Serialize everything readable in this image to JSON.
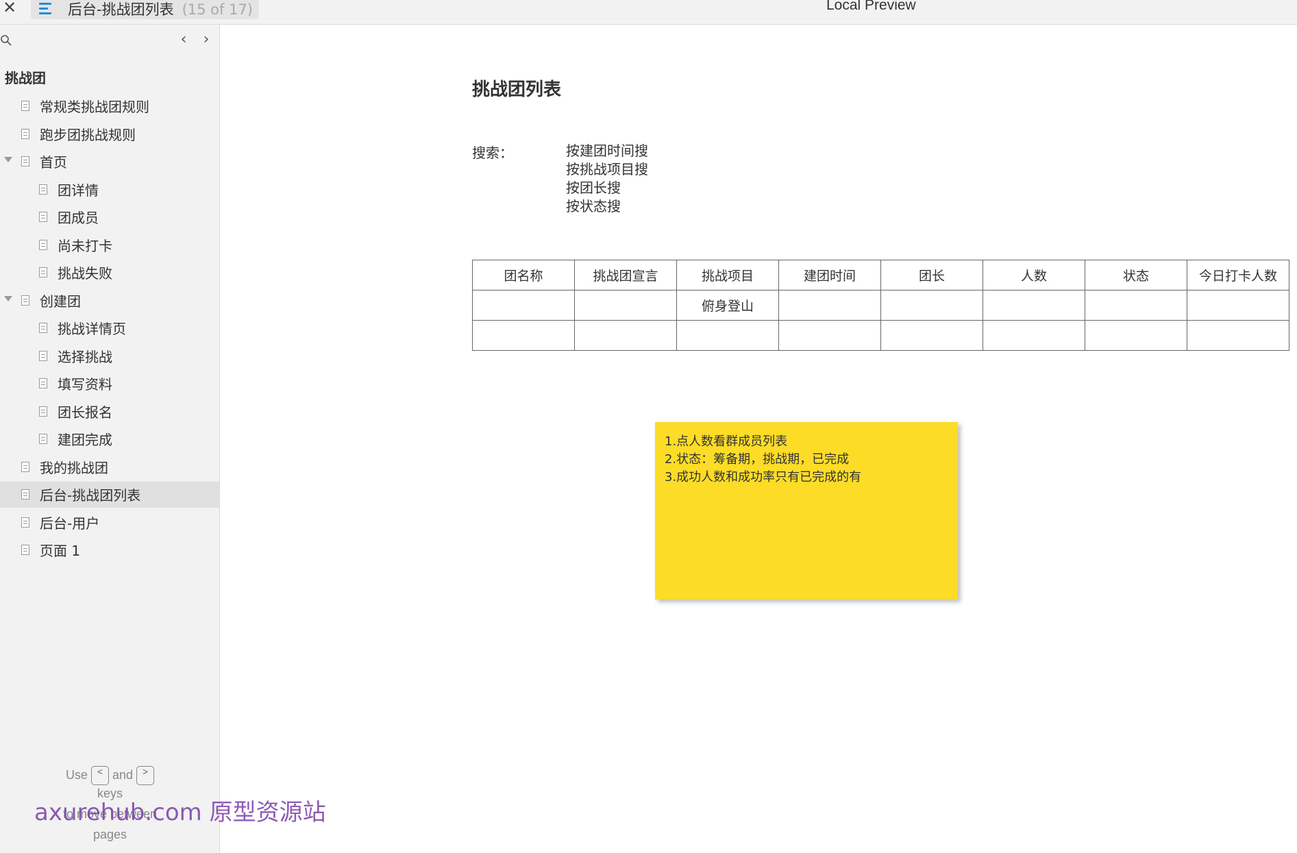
{
  "window": {
    "close_icon": "close-icon",
    "tab_title": "后台-挑战团列表",
    "tab_count": "(15 of 17)",
    "app_title": "Local Preview"
  },
  "sidebar": {
    "section_title": "挑战团",
    "items": [
      {
        "label": "常规类挑战团规则"
      },
      {
        "label": "跑步团挑战规则"
      },
      {
        "label": "首页"
      },
      {
        "label": "团详情"
      },
      {
        "label": "团成员"
      },
      {
        "label": "尚未打卡"
      },
      {
        "label": "挑战失败"
      },
      {
        "label": "创建团"
      },
      {
        "label": "挑战详情页"
      },
      {
        "label": "选择挑战"
      },
      {
        "label": "填写资料"
      },
      {
        "label": "团长报名"
      },
      {
        "label": "建团完成"
      },
      {
        "label": "我的挑战团"
      },
      {
        "label": "后台-挑战团列表"
      },
      {
        "label": "后台-用户"
      },
      {
        "label": "页面 1"
      }
    ],
    "help": {
      "use": "Use",
      "prev_key": "<",
      "and": "and",
      "next_key": ">",
      "keys": "keys",
      "to_move_between": "to move between",
      "pages": "pages"
    }
  },
  "main": {
    "heading": "挑战团列表",
    "search_label": "搜索：",
    "search_options": [
      "按建团时间搜",
      "按挑战项目搜",
      "按团长搜",
      "按状态搜"
    ],
    "table": {
      "columns": [
        "团名称",
        "挑战团宣言",
        "挑战项目",
        "建团时间",
        "团长",
        "人数",
        "状态",
        "今日打卡人数"
      ],
      "rows": [
        [
          "",
          "",
          "俯身登山",
          "",
          "",
          "",
          "",
          ""
        ],
        [
          "",
          "",
          "",
          "",
          "",
          "",
          "",
          ""
        ]
      ]
    },
    "note": [
      "1.点人数看群成员列表",
      "2.状态：筹备期，挑战期，已完成",
      "3.成功人数和成功率只有已完成的有"
    ]
  },
  "watermark": "axurehub.com 原型资源站"
}
